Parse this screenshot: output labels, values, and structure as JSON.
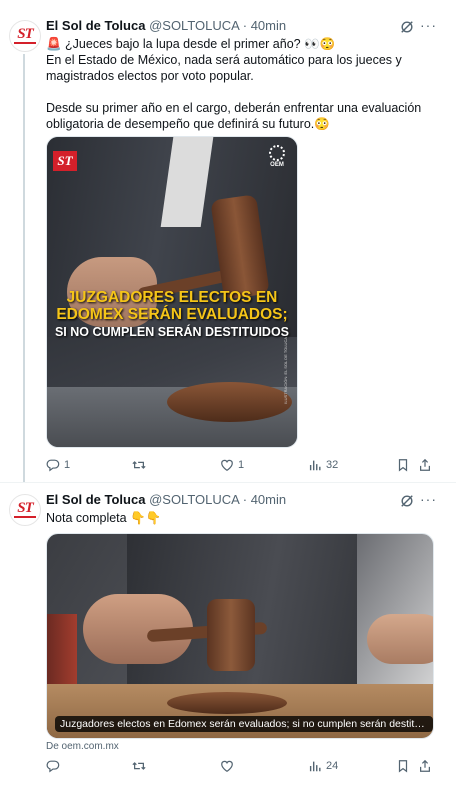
{
  "tweets": [
    {
      "author_name": "El Sol de Toluca",
      "handle": "@SOLTOLUCA",
      "separator": "·",
      "time": "40min",
      "avatar_text": "ST",
      "text_lines": [
        "🚨 ¿Jueces bajo la lupa desde el primer año? 👀😳",
        "En el Estado de México, nada será automático para los jueces y magistrados electos por voto popular.",
        "Desde su primer año en el cargo, deberán enfrentar una evaluación obligatoria de desempeño que definirá su futuro.😳"
      ],
      "media": {
        "logo_text": "ST",
        "oem_text": "OEM",
        "headline_1": "JUZGADORES ELECTOS EN",
        "headline_2": "EDOMEX SERÁN EVALUADOS;",
        "headline_3": "SI NO CUMPLEN SERÁN DESTITUIDOS",
        "side_credit": "ILUSTRACIÓN: EL SOL DE TOLUCA"
      },
      "actions": {
        "reply_count": "1",
        "retweet_count": "",
        "like_count": "1",
        "views_count": "32"
      }
    },
    {
      "author_name": "El Sol de Toluca",
      "handle": "@SOLTOLUCA",
      "separator": "·",
      "time": "40min",
      "avatar_text": "ST",
      "text": "Nota completa 👇👇",
      "link_card": {
        "caption": "Juzgadores electos en Edomex serán evaluados; si no cumplen serán destituid...",
        "source": "De oem.com.mx"
      },
      "actions": {
        "reply_count": "",
        "retweet_count": "",
        "like_count": "",
        "views_count": "24"
      }
    }
  ],
  "colors": {
    "brand_red": "#d4202a",
    "headline_yellow": "#f5c518",
    "muted_text": "#536471",
    "thread_line": "#cfd9de"
  },
  "icons": [
    "grok-icon",
    "more-icon",
    "reply-icon",
    "retweet-icon",
    "like-icon",
    "views-icon",
    "bookmark-icon",
    "share-icon"
  ]
}
